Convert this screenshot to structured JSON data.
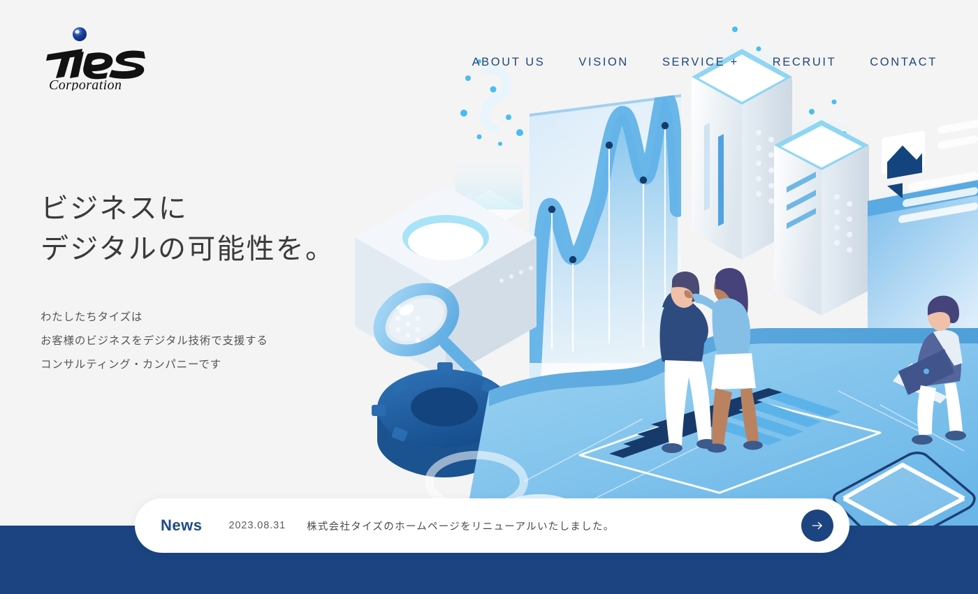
{
  "brand": {
    "logo_text": "Ties",
    "logo_subtext": "Corporation",
    "accent_dot_color": "#1b42a0"
  },
  "nav": {
    "items": [
      {
        "label": "ABOUT US",
        "name": "nav-about-us"
      },
      {
        "label": "VISION",
        "name": "nav-vision"
      },
      {
        "label": "SERVICE +",
        "name": "nav-service"
      },
      {
        "label": "RECRUIT",
        "name": "nav-recruit"
      },
      {
        "label": "CONTACT",
        "name": "nav-contact"
      }
    ]
  },
  "hero": {
    "title": "ビジネスに\nデジタルの可能性を。",
    "lead": "わたしたちタイズは\nお客様のビジネスをデジタル技術で支援する\nコンサルティング・カンパニーです"
  },
  "news": {
    "label": "News",
    "date": "2023.08.31",
    "headline": "株式会社タイズのホームページをリニューアルいたしました。",
    "arrow_icon": "arrow-right-icon"
  },
  "colors": {
    "page_background": "#f4f4f4",
    "brand_navy": "#1b4480",
    "nav_text": "#1f4677",
    "heading_text": "#3a3a3a",
    "body_text": "#555555",
    "accent_blue": "#5fb3e8",
    "light_blue": "#bfe0f7",
    "deep_blue": "#1c5aa0"
  },
  "illustration": {
    "name": "isometric-digital-business-illustration",
    "elements": [
      "magnifier-icon",
      "gear-icon",
      "pedestal-device",
      "analytics-screen",
      "server-tower-tall",
      "server-tower-short",
      "document-card",
      "person-pointing",
      "person-standing",
      "person-with-laptop",
      "bar-chart-panel",
      "donut-chart-large",
      "donut-chart-small",
      "envelope-icon"
    ]
  },
  "chart_data": {
    "type": "area",
    "title": "",
    "x": [
      1,
      2,
      3,
      4,
      5
    ],
    "values": [
      38,
      24,
      72,
      48,
      86
    ],
    "categories": [
      "",
      "",
      "",
      "",
      ""
    ],
    "xlabel": "",
    "ylabel": "",
    "ylim": [
      0,
      100
    ],
    "grid": false,
    "legend": "none",
    "series": [
      {
        "name": "trend",
        "values": [
          38,
          24,
          72,
          48,
          86
        ]
      }
    ],
    "marker_color": "#173a6b",
    "area_color": "#5fb3e8"
  }
}
